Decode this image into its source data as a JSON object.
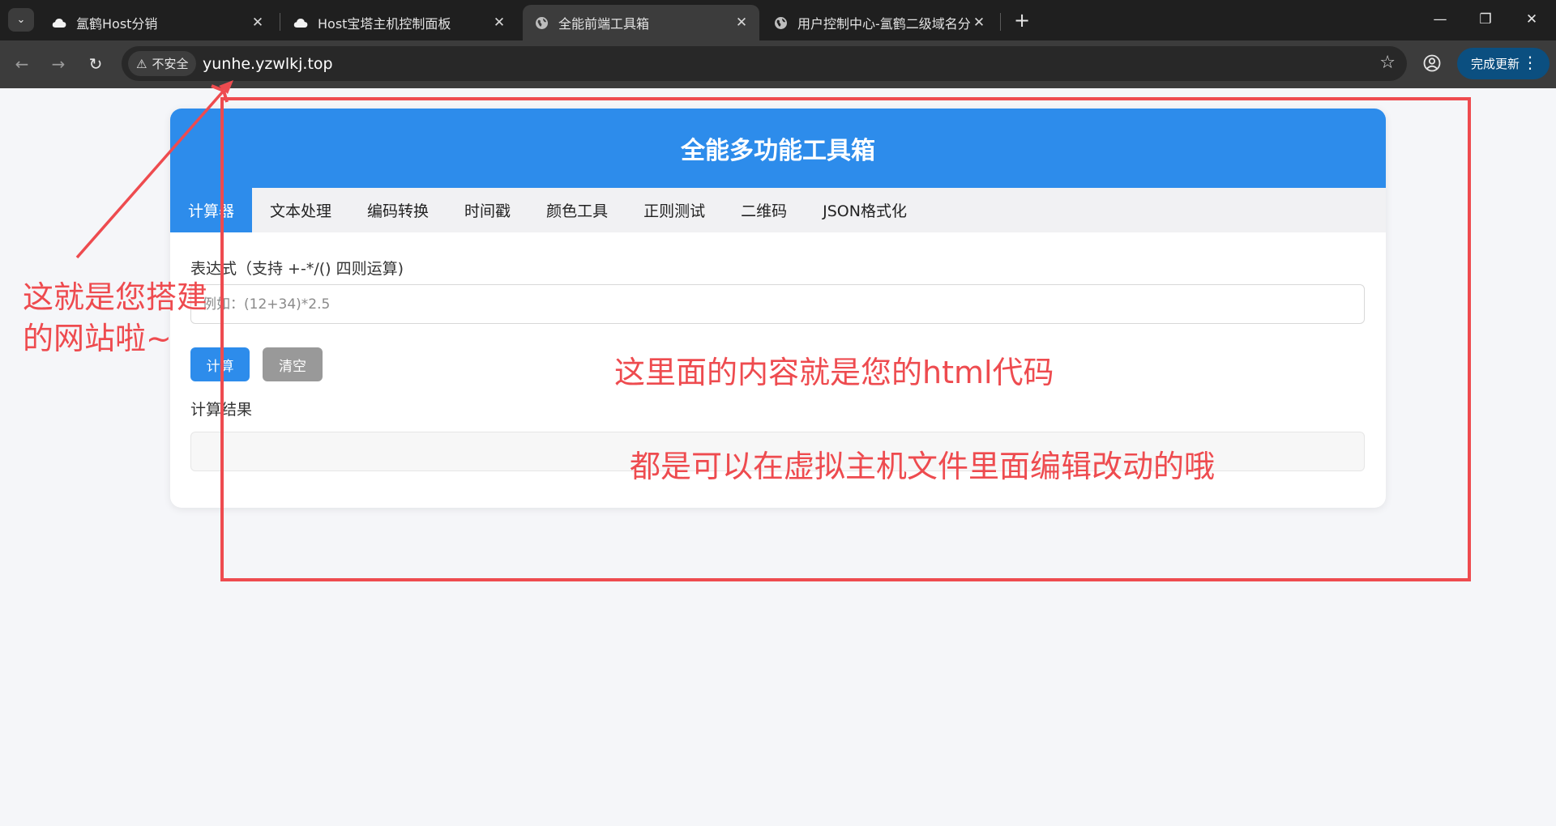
{
  "browser": {
    "tabs": [
      {
        "title": "氲鹤Host分销",
        "icon": "cloud-icon",
        "active": false
      },
      {
        "title": "Host宝塔主机控制面板",
        "icon": "cloud-icon",
        "active": false
      },
      {
        "title": "全能前端工具箱",
        "icon": "globe-icon",
        "active": true
      },
      {
        "title": "用户控制中心-氲鹤二级域名分发",
        "icon": "globe-icon",
        "active": false
      }
    ],
    "security_label": "不安全",
    "url": "yunhe.yzwlkj.top",
    "update_button": "完成更新"
  },
  "page": {
    "title": "全能多功能工具箱",
    "tabs": [
      {
        "label": "计算器",
        "active": true
      },
      {
        "label": "文本处理",
        "active": false
      },
      {
        "label": "编码转换",
        "active": false
      },
      {
        "label": "时间戳",
        "active": false
      },
      {
        "label": "颜色工具",
        "active": false
      },
      {
        "label": "正则测试",
        "active": false
      },
      {
        "label": "二维码",
        "active": false
      },
      {
        "label": "JSON格式化",
        "active": false
      }
    ],
    "calculator": {
      "expression_label": "表达式（支持 +-*/() 四则运算)",
      "expression_placeholder": "例如：(12+34)*2.5",
      "expression_value": "",
      "calc_button": "计算",
      "clear_button": "清空",
      "result_label": "计算结果",
      "result_value": ""
    }
  },
  "annotations": {
    "left_note_line1": "这就是您搭建",
    "left_note_line2": "的网站啦~",
    "center_note": "这里面的内容就是您的html代码",
    "bottom_note": "都是可以在虚拟主机文件里面编辑改动的哦",
    "color": "#ee4b4f"
  },
  "colors": {
    "accent": "#2d8ceb",
    "clear_button": "#999999",
    "annotation": "#ee4b4f"
  }
}
